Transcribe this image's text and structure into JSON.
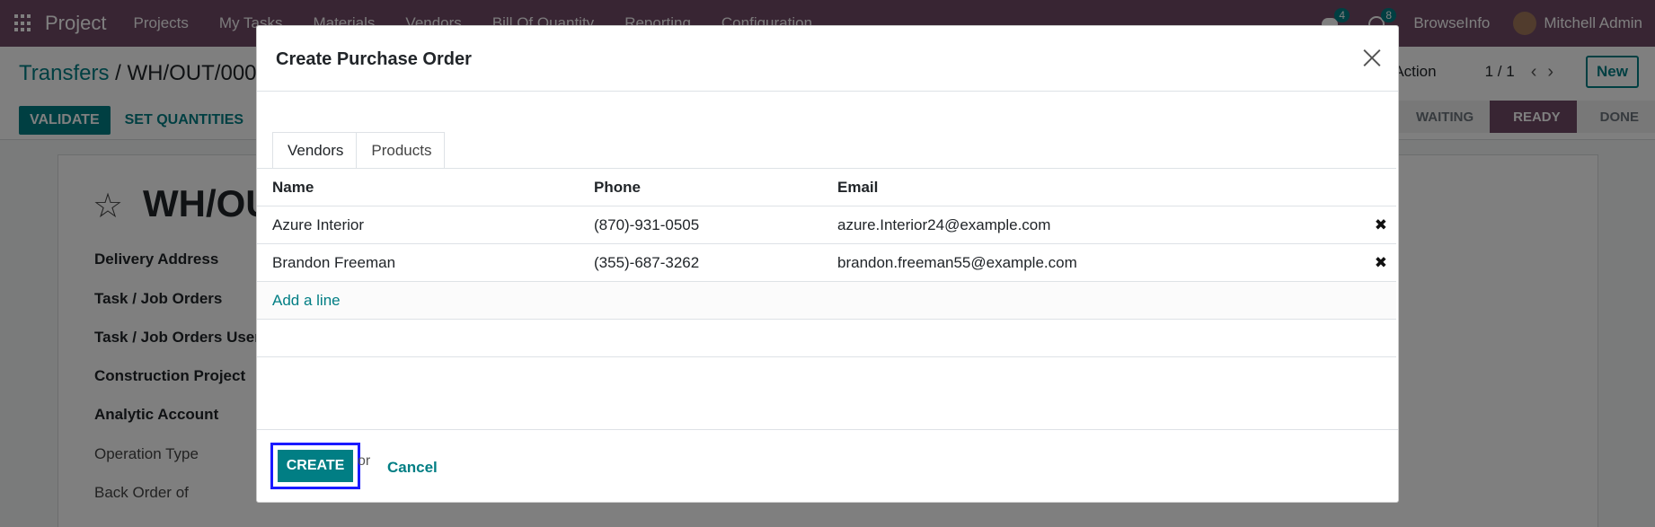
{
  "navbar": {
    "app_name": "Project",
    "menu": [
      "Projects",
      "My Tasks",
      "Materials",
      "Vendors",
      "Bill Of Quantity",
      "Reporting",
      "Configuration"
    ],
    "messages_count": "4",
    "activities_count": "8",
    "company": "BrowseInfo",
    "user": "Mitchell Admin"
  },
  "control_panel": {
    "breadcrumb_parent": "Transfers",
    "breadcrumb_sep": "/",
    "breadcrumb_current": "WH/OUT/000",
    "validate_label": "VALIDATE",
    "set_quantities_label": "SET QUANTITIES",
    "action_label": "Action",
    "pager": "1 / 1",
    "new_label": "New",
    "statuses": [
      "WAITING",
      "READY",
      "DONE"
    ],
    "active_status": "READY"
  },
  "form": {
    "title": "WH/OU",
    "fields": [
      "Delivery Address",
      "Task / Job Orders",
      "Task / Job Orders User",
      "Construction Project",
      "Analytic Account",
      "Operation Type",
      "Back Order of"
    ]
  },
  "modal": {
    "title": "Create Purchase Order",
    "tabs": [
      "Vendors",
      "Products"
    ],
    "columns": {
      "name": "Name",
      "phone": "Phone",
      "email": "Email"
    },
    "rows": [
      {
        "name": "Azure Interior",
        "phone": "(870)-931-0505",
        "email": "azure.Interior24@example.com"
      },
      {
        "name": "Brandon Freeman",
        "phone": "(355)-687-3262",
        "email": "brandon.freeman55@example.com"
      }
    ],
    "add_line": "Add a line",
    "create_label": "CREATE",
    "or_text": "or",
    "cancel_label": "Cancel"
  },
  "colors": {
    "brand": "#714b67",
    "accent": "#017e84",
    "highlight": "#1a1aff"
  }
}
